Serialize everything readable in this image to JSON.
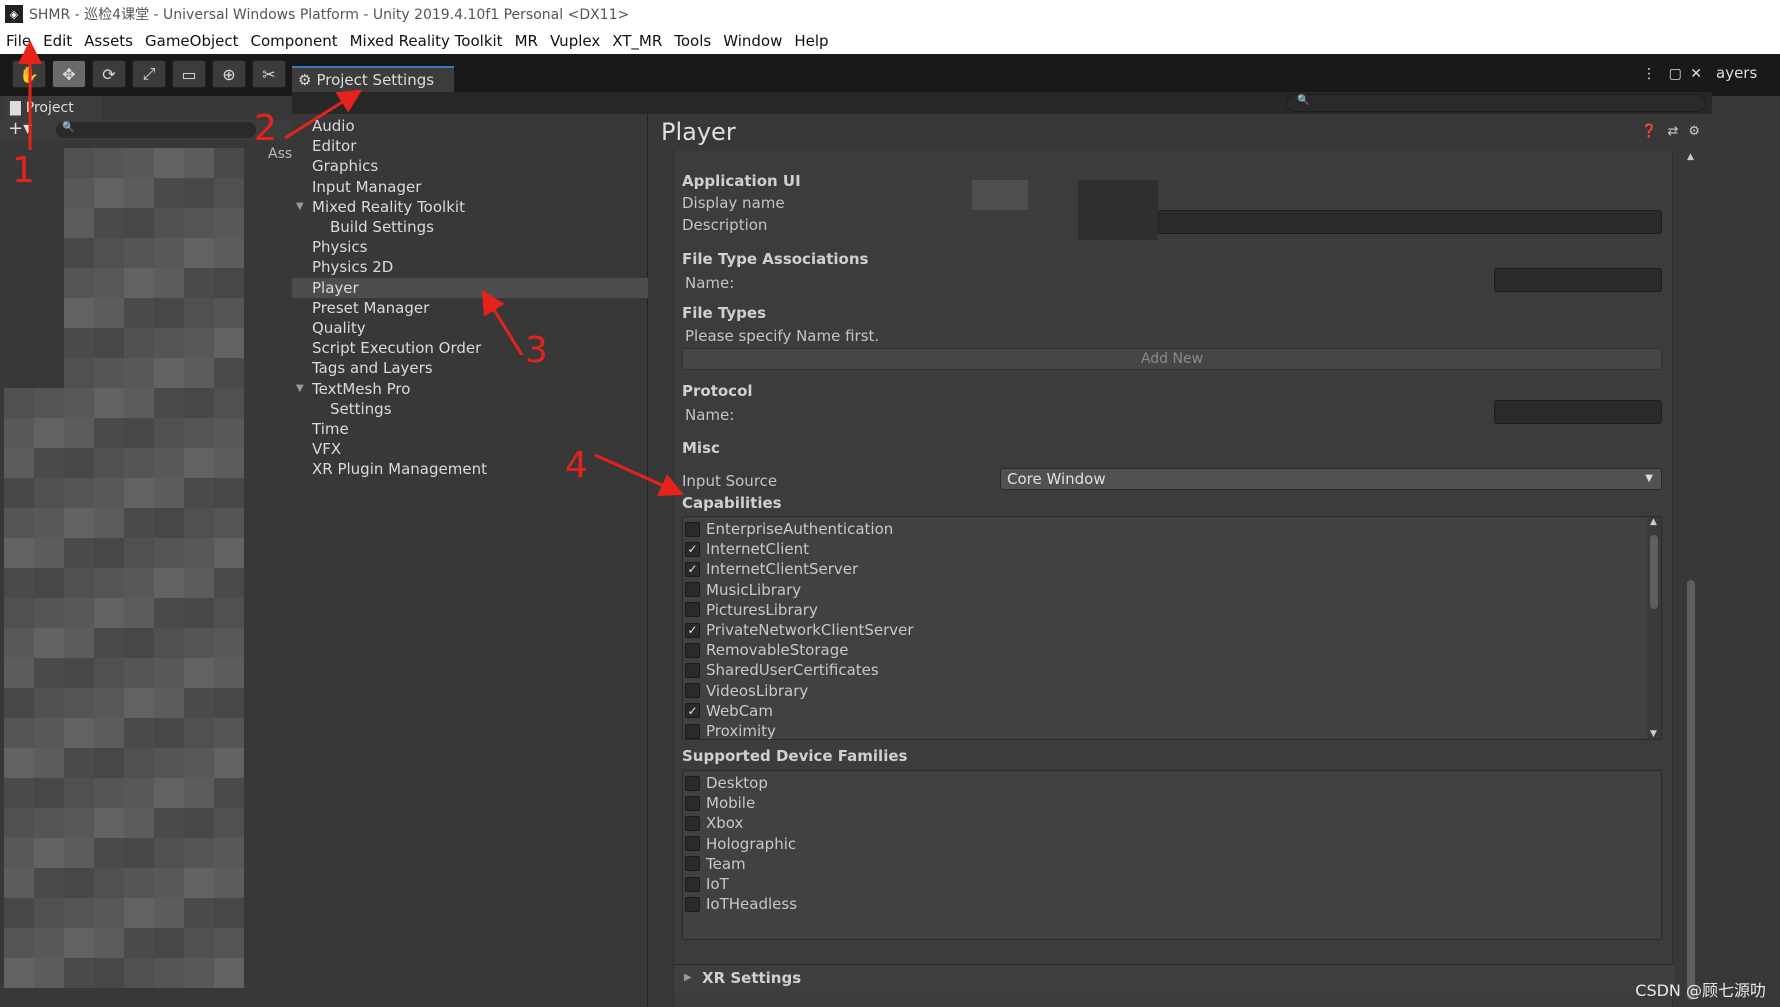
{
  "window": {
    "title": "SHMR - 巡检4课堂 - Universal Windows Platform - Unity 2019.4.10f1 Personal <DX11>"
  },
  "menu": [
    "File",
    "Edit",
    "Assets",
    "GameObject",
    "Component",
    "Mixed Reality Toolkit",
    "MR",
    "Vuplex",
    "XT_MR",
    "Tools",
    "Window",
    "Help"
  ],
  "project_panel": {
    "tab_label": "Project",
    "assets_label": "Ass"
  },
  "settings_window": {
    "tab_label": "Project Settings",
    "layers_label": "ayers"
  },
  "nav": {
    "items": [
      {
        "label": "Audio",
        "level": 0
      },
      {
        "label": "Editor",
        "level": 0
      },
      {
        "label": "Graphics",
        "level": 0
      },
      {
        "label": "Input Manager",
        "level": 0
      },
      {
        "label": "Mixed Reality Toolkit",
        "level": 0,
        "expanded": true
      },
      {
        "label": "Build Settings",
        "level": 1
      },
      {
        "label": "Physics",
        "level": 0
      },
      {
        "label": "Physics 2D",
        "level": 0
      },
      {
        "label": "Player",
        "level": 0,
        "selected": true
      },
      {
        "label": "Preset Manager",
        "level": 0
      },
      {
        "label": "Quality",
        "level": 0
      },
      {
        "label": "Script Execution Order",
        "level": 0
      },
      {
        "label": "Tags and Layers",
        "level": 0
      },
      {
        "label": "TextMesh Pro",
        "level": 0,
        "expanded": true
      },
      {
        "label": "Settings",
        "level": 1
      },
      {
        "label": "Time",
        "level": 0
      },
      {
        "label": "VFX",
        "level": 0
      },
      {
        "label": "XR Plugin Management",
        "level": 0
      }
    ]
  },
  "player": {
    "title": "Player",
    "application_ui": {
      "section": "Application UI",
      "display_name_label": "Display name",
      "description_label": "Description"
    },
    "file_type_associations": {
      "section": "File Type Associations",
      "name_label": "Name:"
    },
    "file_types": {
      "section": "File Types",
      "hint": "Please specify Name first.",
      "add_button": "Add New"
    },
    "protocol": {
      "section": "Protocol",
      "name_label": "Name:"
    },
    "misc": {
      "section": "Misc",
      "input_source_label": "Input Source",
      "input_source_value": "Core Window"
    },
    "capabilities": {
      "section": "Capabilities",
      "items": [
        {
          "label": "EnterpriseAuthentication",
          "checked": false
        },
        {
          "label": "InternetClient",
          "checked": true
        },
        {
          "label": "InternetClientServer",
          "checked": true
        },
        {
          "label": "MusicLibrary",
          "checked": false
        },
        {
          "label": "PicturesLibrary",
          "checked": false
        },
        {
          "label": "PrivateNetworkClientServer",
          "checked": true
        },
        {
          "label": "RemovableStorage",
          "checked": false
        },
        {
          "label": "SharedUserCertificates",
          "checked": false
        },
        {
          "label": "VideosLibrary",
          "checked": false
        },
        {
          "label": "WebCam",
          "checked": true
        },
        {
          "label": "Proximity",
          "checked": false
        }
      ]
    },
    "device_families": {
      "section": "Supported Device Families",
      "items": [
        {
          "label": "Desktop",
          "checked": false
        },
        {
          "label": "Mobile",
          "checked": false
        },
        {
          "label": "Xbox",
          "checked": false
        },
        {
          "label": "Holographic",
          "checked": false
        },
        {
          "label": "Team",
          "checked": false
        },
        {
          "label": "IoT",
          "checked": false
        },
        {
          "label": "IoTHeadless",
          "checked": false
        }
      ]
    },
    "xr_settings": "XR Settings"
  },
  "annotations": [
    "1",
    "2",
    "3",
    "4"
  ],
  "watermark": "CSDN @顾七源叻",
  "colors": {
    "annotation_red": "#e5231b",
    "accent_blue": "#3a79bb",
    "panel_bg": "#383838"
  },
  "icons": {
    "gear": "gear-icon",
    "help": "help-icon",
    "settings": "settings-icon",
    "folder": "folder-icon",
    "search": "search-icon",
    "check": "check-icon"
  }
}
